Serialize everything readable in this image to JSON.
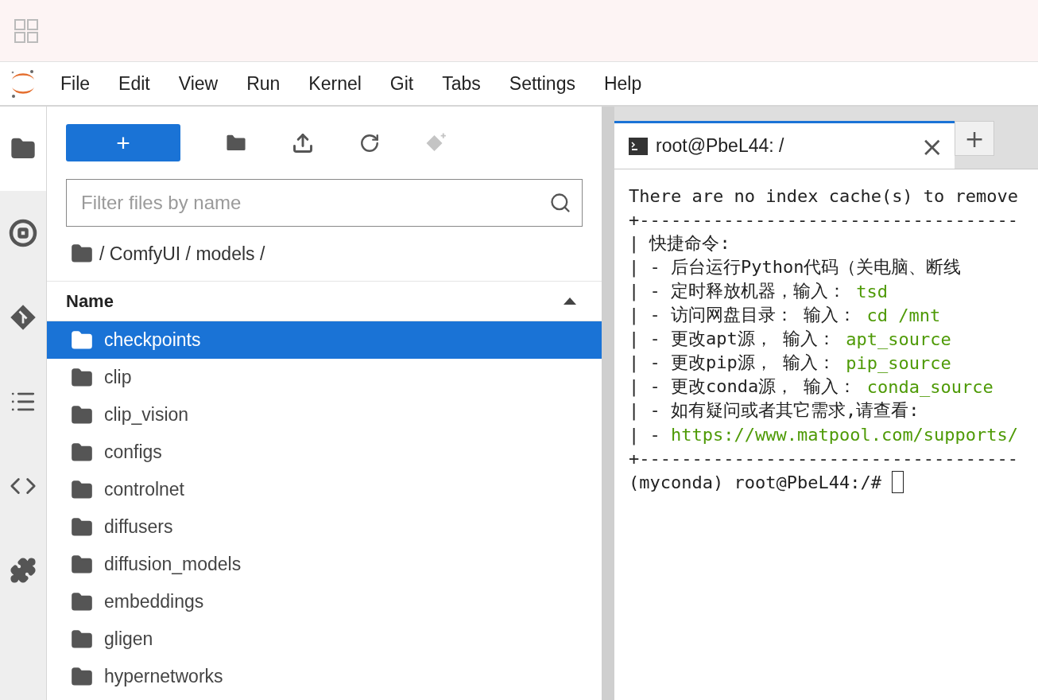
{
  "menu": [
    "File",
    "Edit",
    "View",
    "Run",
    "Kernel",
    "Git",
    "Tabs",
    "Settings",
    "Help"
  ],
  "sidebar": [
    {
      "kind": "folder",
      "selected": true
    },
    {
      "kind": "stop",
      "selected": false
    },
    {
      "kind": "git",
      "selected": false
    },
    {
      "kind": "list",
      "selected": false
    },
    {
      "kind": "code",
      "selected": false
    },
    {
      "kind": "puzzle",
      "selected": false
    }
  ],
  "file_browser": {
    "new_button": "+",
    "filter_placeholder": "Filter files by name",
    "breadcrumb": "/ ComfyUI / models /",
    "column": "Name",
    "files": [
      {
        "name": "checkpoints",
        "selected": true
      },
      {
        "name": "clip",
        "selected": false
      },
      {
        "name": "clip_vision",
        "selected": false
      },
      {
        "name": "configs",
        "selected": false
      },
      {
        "name": "controlnet",
        "selected": false
      },
      {
        "name": "diffusers",
        "selected": false
      },
      {
        "name": "diffusion_models",
        "selected": false
      },
      {
        "name": "embeddings",
        "selected": false
      },
      {
        "name": "gligen",
        "selected": false
      },
      {
        "name": "hypernetworks",
        "selected": false
      }
    ]
  },
  "terminal": {
    "tab_title": "root@PbeL44: /",
    "close": "×",
    "new_tab": "+",
    "lines": [
      {
        "kind": "text",
        "text": "There are no index cache(s) to remove"
      },
      {
        "kind": "text",
        "text": "+------------------------------------"
      },
      {
        "kind": "text",
        "text": "| 快捷命令:"
      },
      {
        "kind": "text",
        "text": "| - 后台运行Python代码（关电脑、断线"
      },
      {
        "kind": "text",
        "text": "| - 定时释放机器，输入： ",
        "command": "tsd"
      },
      {
        "kind": "text",
        "text": "| - 访问网盘目录： 输入： ",
        "command": "cd /mnt"
      },
      {
        "kind": "text",
        "text": "| - 更改apt源， 输入： ",
        "command": "apt_source"
      },
      {
        "kind": "text",
        "text": "| - 更改pip源， 输入： ",
        "command": "pip_source"
      },
      {
        "kind": "text",
        "text": "| - 更改conda源， 输入： ",
        "command": "conda_source"
      },
      {
        "kind": "text",
        "text": "| - 如有疑问或者其它需求,请查看:"
      },
      {
        "kind": "text",
        "text": "| - ",
        "command": "https://www.matpool.com/supports/"
      },
      {
        "kind": "text",
        "text": "+------------------------------------"
      },
      {
        "kind": "prompt",
        "text": "(myconda) root@PbeL44:/# "
      }
    ]
  }
}
